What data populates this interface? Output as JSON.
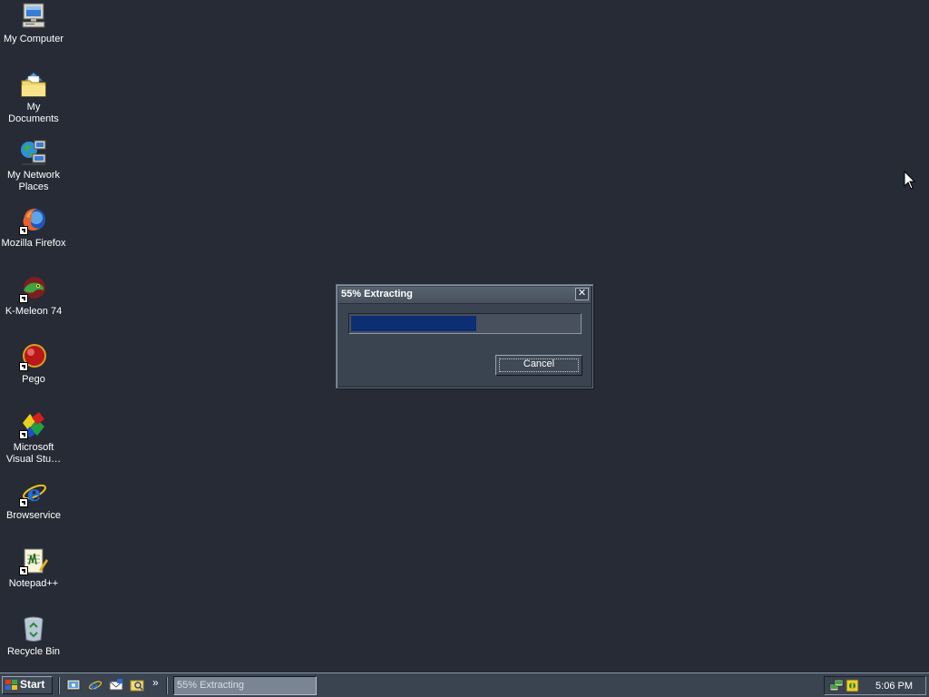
{
  "desktop": {
    "background_color": "#262b35",
    "icons": [
      {
        "label": "My Computer",
        "icon": "computer-icon"
      },
      {
        "label": "My Documents",
        "icon": "folder-icon"
      },
      {
        "label": "My Network Places",
        "icon": "network-icon"
      },
      {
        "label": "Mozilla Firefox",
        "icon": "firefox-icon"
      },
      {
        "label": "K-Meleon 74",
        "icon": "k-meleon-icon"
      },
      {
        "label": "Pego",
        "icon": "pego-icon"
      },
      {
        "label": "Microsoft Visual Stu…",
        "icon": "visual-studio-icon"
      },
      {
        "label": "Browservice",
        "icon": "ie-icon"
      },
      {
        "label": "Notepad++",
        "icon": "notepad-icon"
      },
      {
        "label": "Recycle Bin",
        "icon": "recycle-bin-icon"
      }
    ]
  },
  "dialog": {
    "title": "55% Extracting",
    "close_icon": "close-icon",
    "progress": 0.55,
    "progress_color": "#0e2e73",
    "cancel_label": "Cancel"
  },
  "taskbar": {
    "start_label": "Start",
    "quick_launch": [
      "show-desktop-icon",
      "ie-icon",
      "outlook-icon",
      "explorer-icon"
    ],
    "more_label": "»",
    "task_button_label": "55% Extracting",
    "tray_icons": [
      "network-tray-icon",
      "security-tray-icon"
    ],
    "clock": "5:06 PM"
  }
}
